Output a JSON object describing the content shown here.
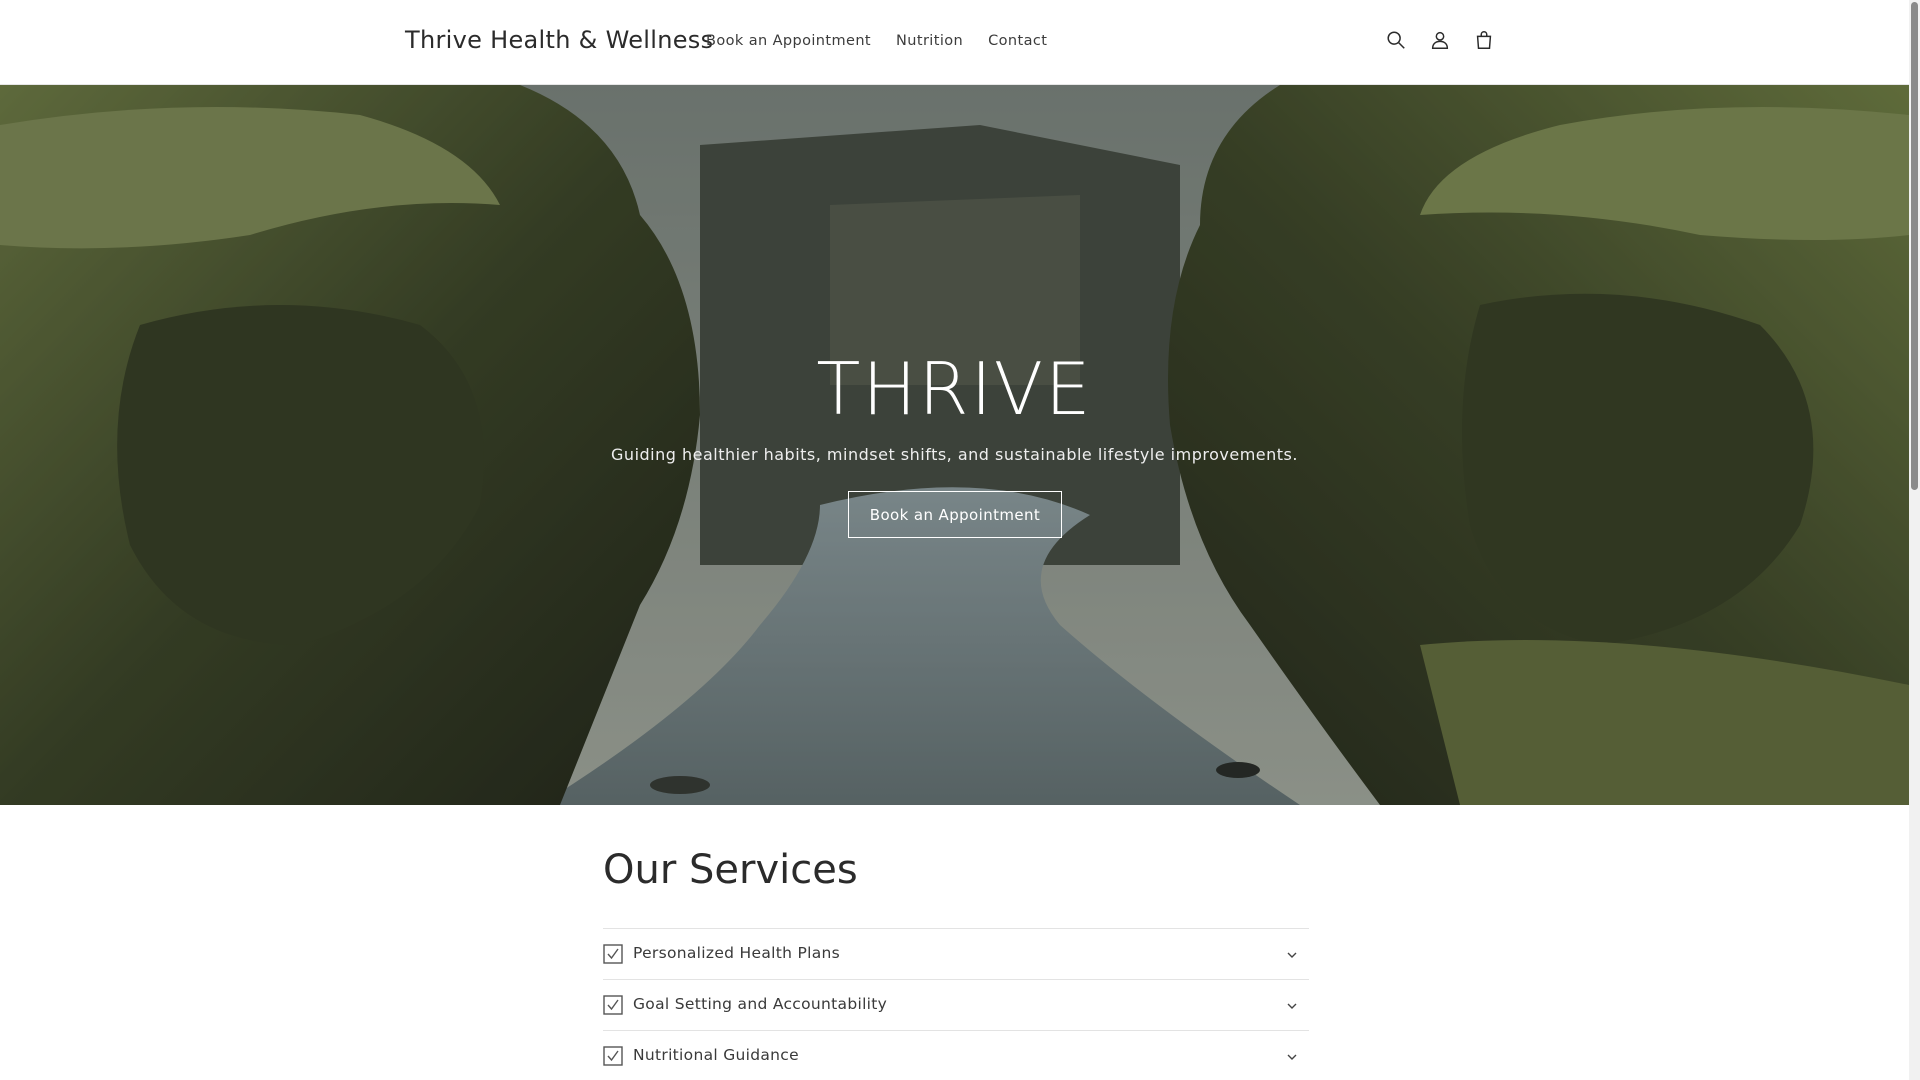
{
  "header": {
    "logo": "Thrive Health & Wellness",
    "nav": [
      {
        "label": "Book an Appointment"
      },
      {
        "label": "Nutrition"
      },
      {
        "label": "Contact"
      }
    ],
    "icons": [
      "search-icon",
      "account-icon",
      "cart-icon"
    ]
  },
  "hero": {
    "title": "THRIVE",
    "subtitle": "Guiding healthier habits, mindset shifts, and sustainable lifestyle improvements.",
    "button_label": "Book an Appointment"
  },
  "services": {
    "title": "Our Services",
    "items": [
      {
        "label": "Personalized Health Plans"
      },
      {
        "label": "Goal Setting and Accountability"
      },
      {
        "label": "Nutritional Guidance"
      }
    ]
  },
  "colors": {
    "text": "#121212",
    "hero_overlay": "#14161288",
    "button_border": "#ffffff"
  }
}
